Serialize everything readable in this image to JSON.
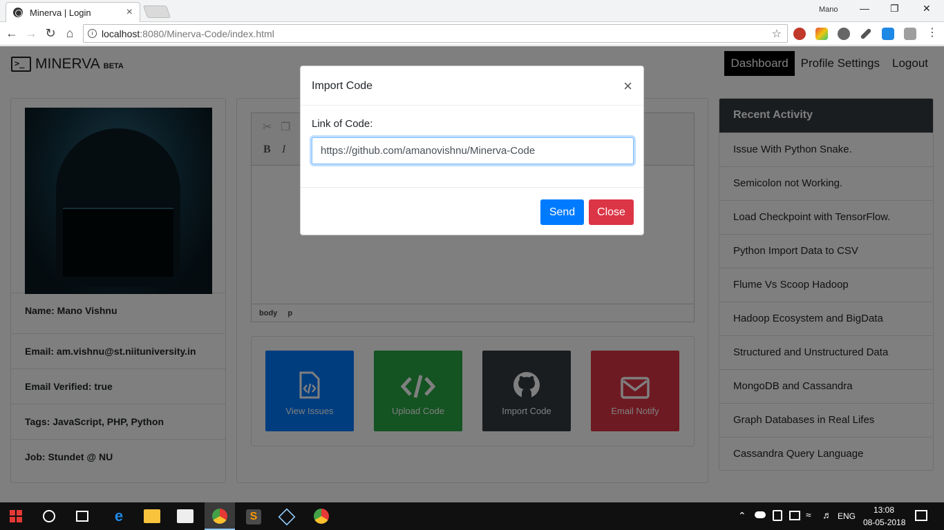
{
  "browser": {
    "tab_title": "Minerva | Login",
    "tab_close": "×",
    "window_user": "Mano",
    "url_host": "localhost",
    "url_rest": ":8080/Minerva-Code/index.html"
  },
  "navbar": {
    "brand": "MINERVA",
    "beta": "BETA",
    "links": [
      "Dashboard",
      "Profile Settings",
      "Logout"
    ]
  },
  "profile": {
    "name": "Name: Mano Vishnu",
    "email": "Email: am.vishnu@st.niituniversity.in",
    "verified": "Email Verified: true",
    "tags": "Tags: JavaScript, PHP, Python",
    "job": "Job: Stundet @ NU"
  },
  "editor": {
    "status_path": [
      "body",
      "p"
    ]
  },
  "tiles": [
    {
      "label": "View Issues",
      "icon": "file-code-icon",
      "color": "#007bff"
    },
    {
      "label": "Upload Code",
      "icon": "code-icon",
      "color": "#28a745"
    },
    {
      "label": "Import Code",
      "icon": "github-icon",
      "color": "#343a40"
    },
    {
      "label": "Email Notify",
      "icon": "envelope-icon",
      "color": "#dc3545"
    }
  ],
  "activity": {
    "title": "Recent Activity",
    "items": [
      "Issue With Python Snake.",
      "Semicolon not Working.",
      "Load Checkpoint with TensorFlow.",
      "Python Import Data to CSV",
      "Flume Vs Scoop Hadoop",
      "Hadoop Ecosystem and BigData",
      "Structured and Unstructured Data",
      "MongoDB and Cassandra",
      "Graph Databases in Real Lifes",
      "Cassandra Query Language"
    ]
  },
  "modal": {
    "title": "Import Code",
    "close_symbol": "×",
    "label": "Link of Code:",
    "input_value": "https://github.com/amanovishnu/Minerva-Code",
    "send": "Send",
    "close": "Close"
  },
  "taskbar": {
    "time": "13:08",
    "date": "08-05-2018",
    "lang": "ENG"
  }
}
